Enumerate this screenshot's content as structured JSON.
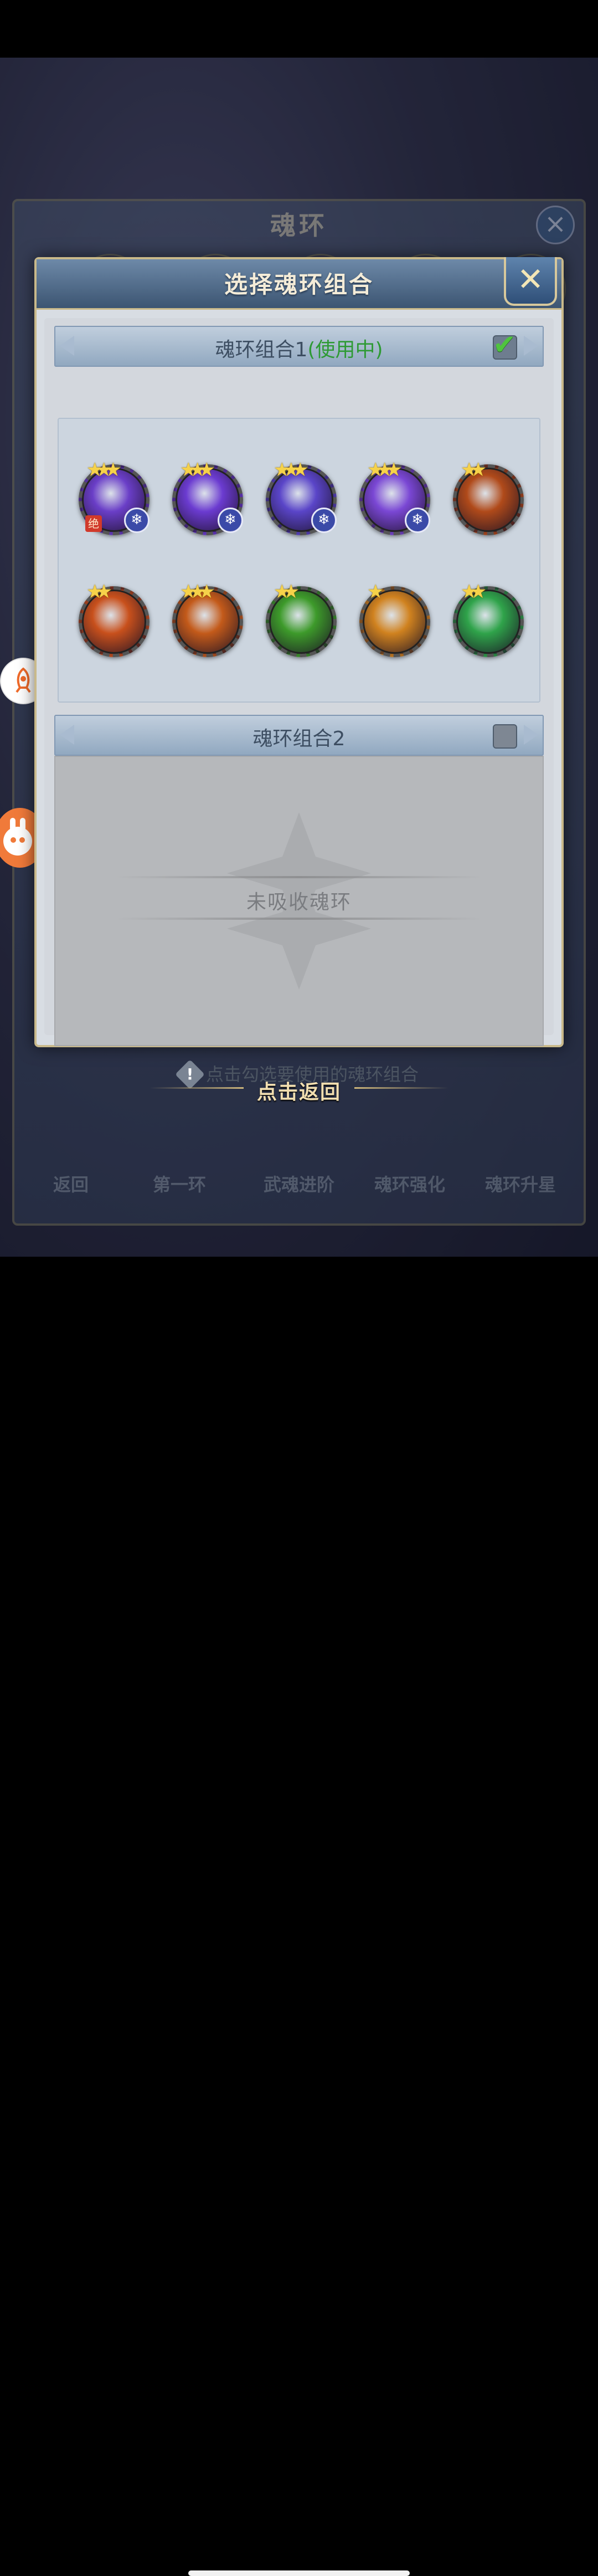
{
  "background": {
    "title": "魂环",
    "nav": [
      "返回",
      "第一环",
      "武魂进阶",
      "魂环强化",
      "魂环升星"
    ]
  },
  "dialog": {
    "title": "选择魂环组合",
    "close_icon": "close-icon",
    "group1": {
      "label": "魂环组合1",
      "status": "(使用中)",
      "checked": true,
      "rings": [
        {
          "stars": 3,
          "color": "#6a3ec7",
          "badge": "❄",
          "tag": "绝"
        },
        {
          "stars": 3,
          "color": "#6b3bd0",
          "badge": "❄"
        },
        {
          "stars": 3,
          "color": "#5a45c8",
          "badge": "❄"
        },
        {
          "stars": 3,
          "color": "#7a47d4",
          "badge": "❄"
        },
        {
          "stars": 2,
          "color": "#b04a1a"
        },
        {
          "stars": 2,
          "color": "#c8501c"
        },
        {
          "stars": 3,
          "color": "#c35a1a"
        },
        {
          "stars": 2,
          "color": "#3d9a2a"
        },
        {
          "stars": 1,
          "color": "#d0821f"
        },
        {
          "stars": 2,
          "color": "#2fa34a"
        }
      ]
    },
    "group2": {
      "label": "魂环组合2",
      "checked": false,
      "empty_text": "未吸收魂环"
    },
    "hint": "点击勾选要使用的魂环组合"
  },
  "back_text": "点击返回",
  "colors": {
    "accent_green": "#2e9a34",
    "gold": "#c9b98a"
  }
}
